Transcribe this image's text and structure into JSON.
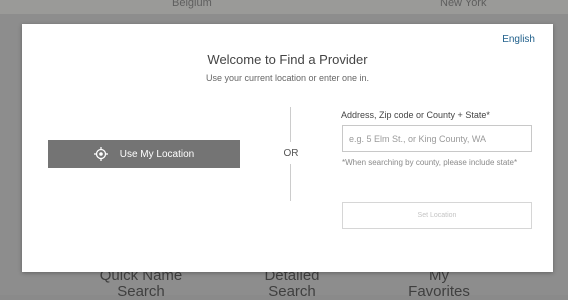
{
  "background": {
    "top_left_text": "Belgium",
    "top_right_text": "New York",
    "nav": [
      {
        "line1": "Quick Name",
        "line2": "Search"
      },
      {
        "line1": "Detailed",
        "line2": "Search"
      },
      {
        "line1": "My",
        "line2": "Favorites"
      }
    ]
  },
  "modal": {
    "language_link": "English",
    "title": "Welcome to Find a Provider",
    "subtitle": "Use your current location or enter one in.",
    "use_location_button": "Use My Location",
    "or_label": "OR",
    "address_label": "Address, Zip code or County + State*",
    "address_placeholder": "e.g. 5 Elm St., or King County, WA",
    "hint": "*When searching by county, please include state*",
    "set_location_button": "Set Location"
  },
  "colors": {
    "accent_link": "#1f5f8b",
    "primary_button": "#747474"
  },
  "icons": {
    "use_location": "crosshair-icon"
  }
}
